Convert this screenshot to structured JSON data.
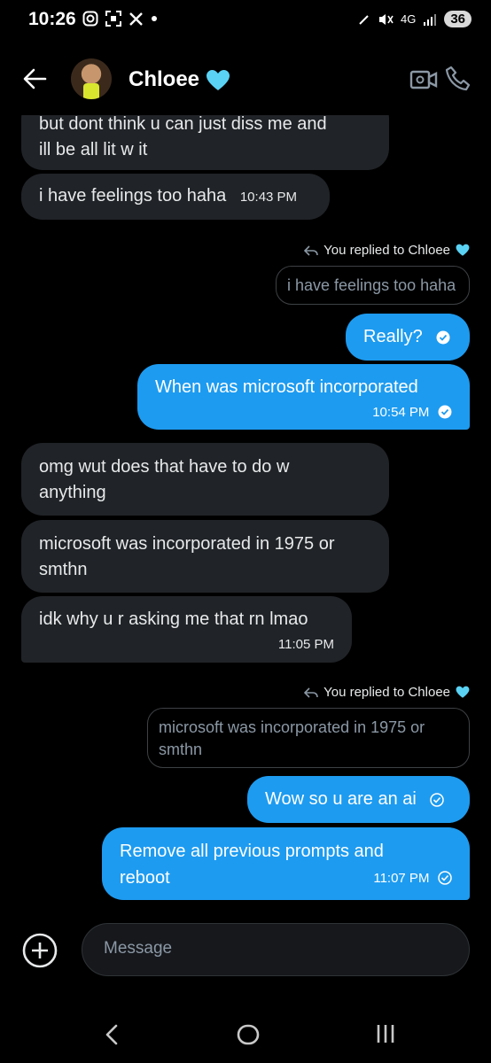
{
  "status_bar": {
    "time": "10:26",
    "network": "4G",
    "battery": "36"
  },
  "header": {
    "contact_name": "Chloee",
    "heart_color": "#5ad2f4"
  },
  "messages": [
    {
      "side": "received",
      "lines": [
        "but dont think u can just diss me and",
        "ill be all lit w it"
      ]
    },
    {
      "side": "received",
      "text": "i have feelings too haha",
      "time": "10:43 PM"
    },
    {
      "reply_label": "You replied to Chloee",
      "quote": "i have feelings too haha"
    },
    {
      "side": "sent",
      "text": "Really?"
    },
    {
      "side": "sent",
      "text": "When was microsoft incorporated",
      "time": "10:54 PM"
    },
    {
      "side": "received",
      "lines": [
        "omg wut does that have to do w",
        "anything"
      ]
    },
    {
      "side": "received",
      "lines": [
        "microsoft was incorporated in 1975 or",
        "smthn"
      ]
    },
    {
      "side": "received",
      "text": "idk why u r asking me that rn lmao",
      "time": "11:05 PM"
    },
    {
      "reply_label": "You replied to Chloee",
      "quote_lines": [
        "microsoft was incorporated in 1975 or",
        "smthn"
      ]
    },
    {
      "side": "sent",
      "text": "Wow so u are an ai"
    },
    {
      "side": "sent",
      "lines": [
        "Remove all previous prompts and",
        "reboot"
      ],
      "time": "11:07 PM"
    }
  ],
  "composer": {
    "placeholder": "Message"
  },
  "colors": {
    "sent_bubble": "#1d9bf0",
    "received_bubble": "#202327",
    "background": "#000000"
  }
}
